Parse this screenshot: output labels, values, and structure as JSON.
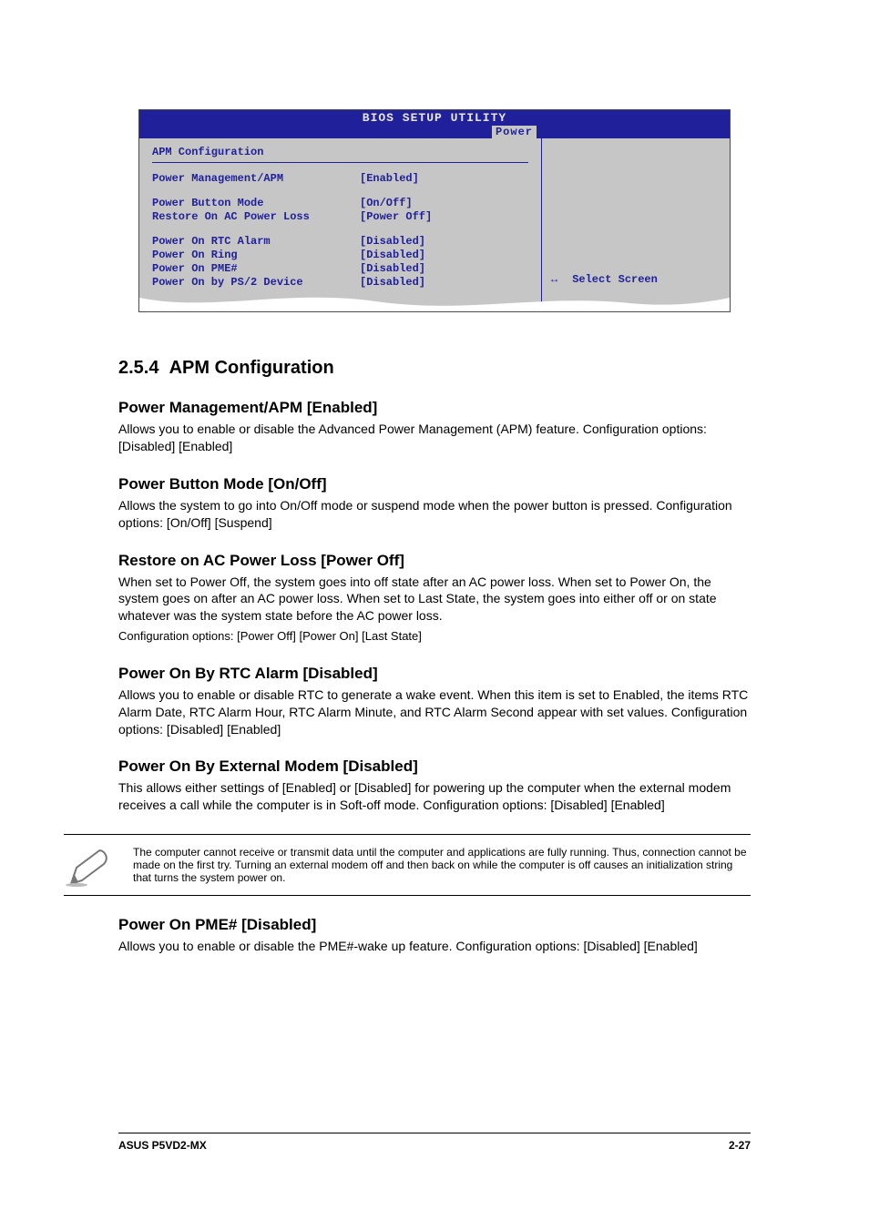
{
  "bios": {
    "title": "BIOS SETUP UTILITY",
    "tab": "Power",
    "section": "APM Configuration",
    "rows": [
      {
        "label": "Power Management/APM",
        "value": "[Enabled]"
      }
    ],
    "rows2": [
      {
        "label": "Power Button Mode",
        "value": "[On/Off]"
      },
      {
        "label": "Restore On AC Power Loss",
        "value": "[Power Off]"
      }
    ],
    "rows3": [
      {
        "label": "Power On RTC Alarm",
        "value": "[Disabled]"
      },
      {
        "label": "Power On Ring",
        "value": "[Disabled]"
      },
      {
        "label": "Power On PME#",
        "value": "[Disabled]"
      },
      {
        "label": "Power On by PS/2 Device",
        "value": "[Disabled]"
      }
    ],
    "help_arrows": "↔",
    "help_text": "Select Screen"
  },
  "doc": {
    "s1_num": "2.5.4",
    "s1_title": "APM Configuration",
    "s2": "Power Management/APM [Enabled]",
    "s2_body": "Allows you to enable or disable the Advanced Power Management (APM) feature. Configuration options: [Disabled] [Enabled]",
    "s3": "Power Button Mode [On/Off]",
    "s3_body": "Allows the system to go into On/Off mode or suspend mode when the power button is pressed. Configuration options: [On/Off] [Suspend]",
    "s4": "Restore on AC Power Loss [Power Off]",
    "s4_body1": "When set to Power Off, the system goes into off state after an AC power loss. When set to Power On, the system goes on after an AC power loss. When set to Last State, the system goes into either off or on state whatever was the system state before the AC power loss.",
    "s4_body2": "Configuration options: [Power Off] [Power On] [Last State]",
    "s5": "Power On By RTC Alarm [Disabled]",
    "s5_body": "Allows you to enable or disable RTC to generate a wake event. When this item is set to Enabled, the items RTC Alarm Date, RTC Alarm Hour, RTC Alarm Minute, and RTC Alarm Second appear with set values. Configuration options: [Disabled] [Enabled]",
    "s6": "Power On By External Modem [Disabled]",
    "s6_body": "This allows either settings of [Enabled] or [Disabled] for powering up the computer when the external modem receives a call while the computer is in Soft-off mode. Configuration options: [Disabled] [Enabled]",
    "note": "The computer cannot receive or transmit data until the computer and applications are fully running. Thus, connection cannot be made on the first try. Turning an external modem off and then back on while the computer is off causes an initialization string that turns the system power on.",
    "s7": "Power On PME# [Disabled]",
    "s7_body": "Allows you to enable or disable the PME#-wake up feature. Configuration options: [Disabled] [Enabled]"
  },
  "footer": {
    "left": "ASUS P5VD2-MX",
    "right": "2-27"
  }
}
